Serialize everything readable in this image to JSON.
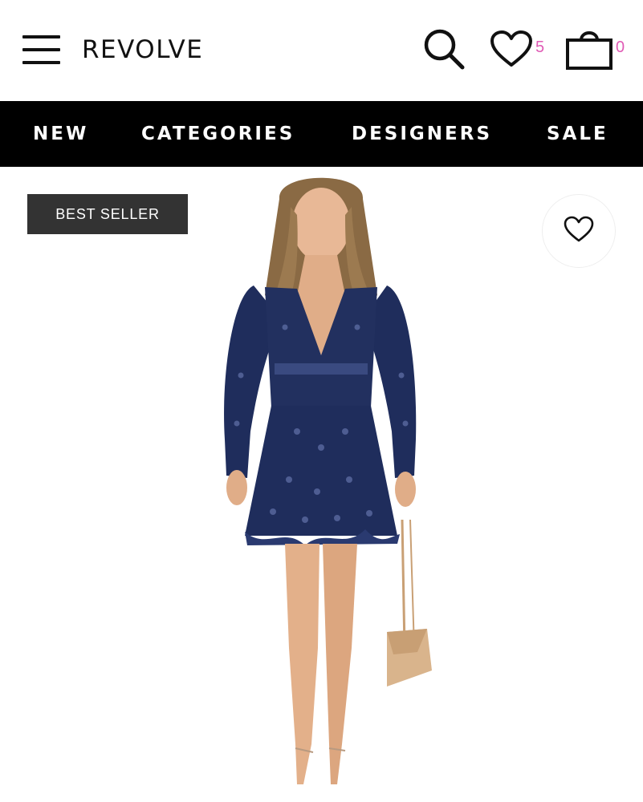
{
  "header": {
    "menu_icon": "hamburger-menu-icon",
    "logo_text": "REVOLVE",
    "search_icon": "search-icon",
    "wishlist_icon": "heart-icon",
    "wishlist_count": "5",
    "bag_icon": "shopping-bag-icon",
    "bag_count": "0"
  },
  "nav": {
    "items": [
      {
        "label": "NEW"
      },
      {
        "label": "CATEGORIES"
      },
      {
        "label": "DESIGNERS"
      },
      {
        "label": "SALE"
      }
    ]
  },
  "product": {
    "badge": "BEST SELLER",
    "favorite_icon": "heart-outline-icon",
    "image_alt": "model wearing navy eyelet mini dress"
  },
  "colors": {
    "badge_accent": "#e05bb5",
    "nav_background": "#000000",
    "badge_background": "#333333",
    "dress_navy": "#1f2d5c"
  }
}
